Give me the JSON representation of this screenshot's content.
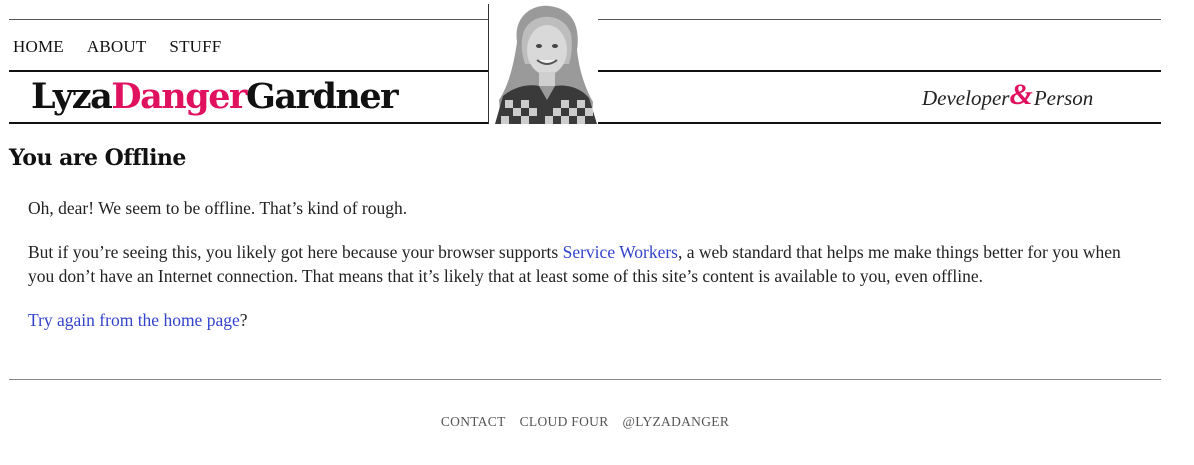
{
  "nav": {
    "items": [
      {
        "label": "HOME"
      },
      {
        "label": "ABOUT"
      },
      {
        "label": "STUFF"
      }
    ]
  },
  "logo": {
    "first": "Lyza",
    "middle": "Danger",
    "last": "Gardner",
    "accent_color": "#e0115f"
  },
  "tagline": {
    "left": "Developer",
    "amp": "&",
    "right": "Person"
  },
  "main": {
    "title": "You are Offline",
    "p1": "Oh, dear! We seem to be offline. That’s kind of rough.",
    "p2_before": "But if you’re seeing this, you likely got here because your browser supports ",
    "p2_link": "Service Workers",
    "p2_after": ", a web standard that helps me make things better for you when you don’t have an Internet connection. That means that it’s likely that at least some of this site’s content is available to you, even offline.",
    "p3_link": "Try again from the home page",
    "p3_after": "?"
  },
  "footer": {
    "items": [
      {
        "label": "CONTACT"
      },
      {
        "label": "CLOUD FOUR"
      },
      {
        "label": "@LYZADANGER"
      }
    ]
  },
  "colors": {
    "link": "#3344cc",
    "accent": "#e0115f"
  }
}
